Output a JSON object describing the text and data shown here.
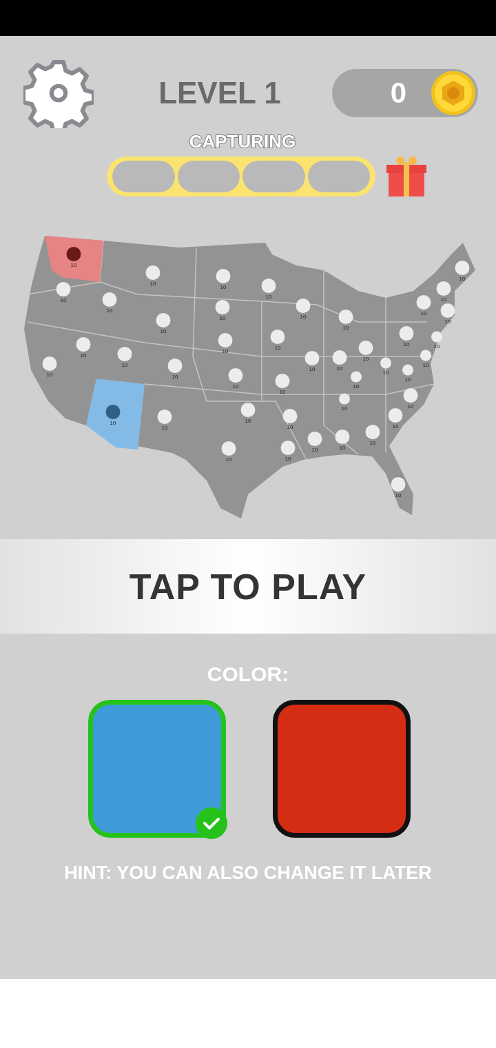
{
  "header": {
    "level": "LEVEL 1",
    "coins": "0"
  },
  "capture": {
    "label": "CAPTURING",
    "segments": [
      {
        "filled": false
      },
      {
        "filled": false
      },
      {
        "filled": false
      },
      {
        "filled": false
      }
    ]
  },
  "map": {
    "territories": [
      {
        "count": "10",
        "color": "#6b1a1a"
      },
      {
        "count": "10",
        "color": "#ececec"
      },
      {
        "count": "10",
        "color": "#ececec"
      },
      {
        "count": "10",
        "color": "#ececec"
      },
      {
        "count": "10",
        "color": "#ececec"
      },
      {
        "count": "10",
        "color": "#ececec"
      },
      {
        "count": "10",
        "color": "#ececec"
      },
      {
        "count": "10",
        "color": "#ececec"
      },
      {
        "count": "10",
        "color": "#ececec"
      },
      {
        "count": "10",
        "color": "#ececec"
      },
      {
        "count": "10",
        "color": "#ececec"
      },
      {
        "count": "10",
        "color": "#ececec"
      },
      {
        "count": "10",
        "color": "#2f5f86"
      },
      {
        "count": "10",
        "color": "#ececec"
      },
      {
        "count": "10",
        "color": "#ececec"
      },
      {
        "count": "10",
        "color": "#ececec"
      },
      {
        "count": "10",
        "color": "#ececec"
      },
      {
        "count": "10",
        "color": "#ececec"
      },
      {
        "count": "10",
        "color": "#ececec"
      },
      {
        "count": "10",
        "color": "#ececec"
      },
      {
        "count": "10",
        "color": "#ececec"
      },
      {
        "count": "10",
        "color": "#ececec"
      },
      {
        "count": "10",
        "color": "#ececec"
      },
      {
        "count": "10",
        "color": "#ececec"
      },
      {
        "count": "10",
        "color": "#ececec"
      },
      {
        "count": "10",
        "color": "#ececec"
      },
      {
        "count": "10",
        "color": "#ececec"
      },
      {
        "count": "10",
        "color": "#ececec"
      },
      {
        "count": "10",
        "color": "#ececec"
      },
      {
        "count": "10",
        "color": "#ececec"
      },
      {
        "count": "10",
        "color": "#ececec"
      },
      {
        "count": "10",
        "color": "#ececec"
      },
      {
        "count": "10",
        "color": "#ececec"
      },
      {
        "count": "10",
        "color": "#ececec"
      },
      {
        "count": "10",
        "color": "#ececec"
      },
      {
        "count": "10",
        "color": "#ececec"
      },
      {
        "count": "10",
        "color": "#ececec"
      },
      {
        "count": "10",
        "color": "#ececec"
      },
      {
        "count": "10",
        "color": "#ececec"
      },
      {
        "count": "10",
        "color": "#ececec"
      },
      {
        "count": "10",
        "color": "#ececec"
      },
      {
        "count": "10",
        "color": "#ececec"
      },
      {
        "count": "10",
        "color": "#ececec"
      },
      {
        "count": "10",
        "color": "#ececec"
      }
    ]
  },
  "play_prompt": "TAP TO PLAY",
  "color_picker": {
    "label": "COLOR:",
    "options": [
      {
        "color": "#3f9bd8",
        "selected": true
      },
      {
        "color": "#d42d14",
        "selected": false
      }
    ],
    "hint": "HINT: YOU CAN ALSO CHANGE IT LATER"
  }
}
